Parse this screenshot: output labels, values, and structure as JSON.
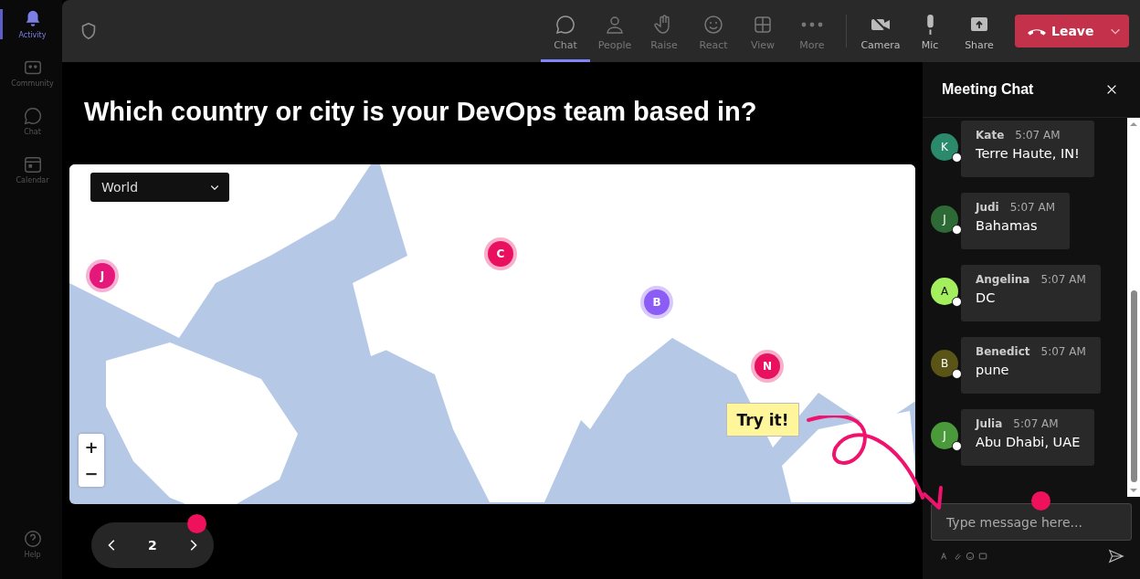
{
  "sidebar": {
    "items": [
      {
        "label": "Activity",
        "selected": true
      },
      {
        "label": "Community",
        "selected": false
      },
      {
        "label": "Chat",
        "selected": false
      },
      {
        "label": "Calendar",
        "selected": false
      }
    ],
    "footer_item": {
      "label": "Help"
    }
  },
  "toolbar": {
    "items": [
      {
        "label": "Chat",
        "selected": true
      },
      {
        "label": "People",
        "selected": false
      },
      {
        "label": "Raise",
        "selected": false
      },
      {
        "label": "React",
        "selected": false
      },
      {
        "label": "View",
        "selected": false
      },
      {
        "label": "More",
        "selected": false
      }
    ],
    "device_items": [
      {
        "label": "Camera"
      },
      {
        "label": "Mic"
      },
      {
        "label": "Share"
      }
    ],
    "leave_button": {
      "label": "Leave"
    }
  },
  "question": {
    "title": "Which country or city is your DevOps team based in?"
  },
  "map": {
    "region_dropdown": {
      "value": "World"
    },
    "markers": [
      {
        "letter": "J",
        "color": "#e5177a"
      },
      {
        "letter": "C",
        "color": "#e8105f"
      },
      {
        "letter": "B",
        "color": "#8b5cf6"
      },
      {
        "letter": "N",
        "color": "#e8105f"
      }
    ],
    "zoom_in": "+",
    "zoom_out": "−",
    "note": "Try it!"
  },
  "pager": {
    "page": "2"
  },
  "chat": {
    "title": "Meeting Chat",
    "messages": [
      {
        "initial": "K",
        "name": "Kate",
        "time": "5:07 AM",
        "text": "Terre Haute, IN!",
        "color": "#2b8a6b"
      },
      {
        "initial": "J",
        "name": "Judi",
        "time": "5:07 AM",
        "text": "Bahamas",
        "color": "#2d6a35"
      },
      {
        "initial": "A",
        "name": "Angelina",
        "time": "5:07 AM",
        "text": "DC",
        "color": "#a4ef5e"
      },
      {
        "initial": "B",
        "name": "Benedict",
        "time": "5:07 AM",
        "text": "pune",
        "color": "#5a5416"
      },
      {
        "initial": "J",
        "name": "Julia",
        "time": "5:07 AM",
        "text": "Abu Dhabi, UAE",
        "color": "#4a9a3c"
      }
    ],
    "composer": {
      "placeholder": "Type message here..."
    }
  }
}
